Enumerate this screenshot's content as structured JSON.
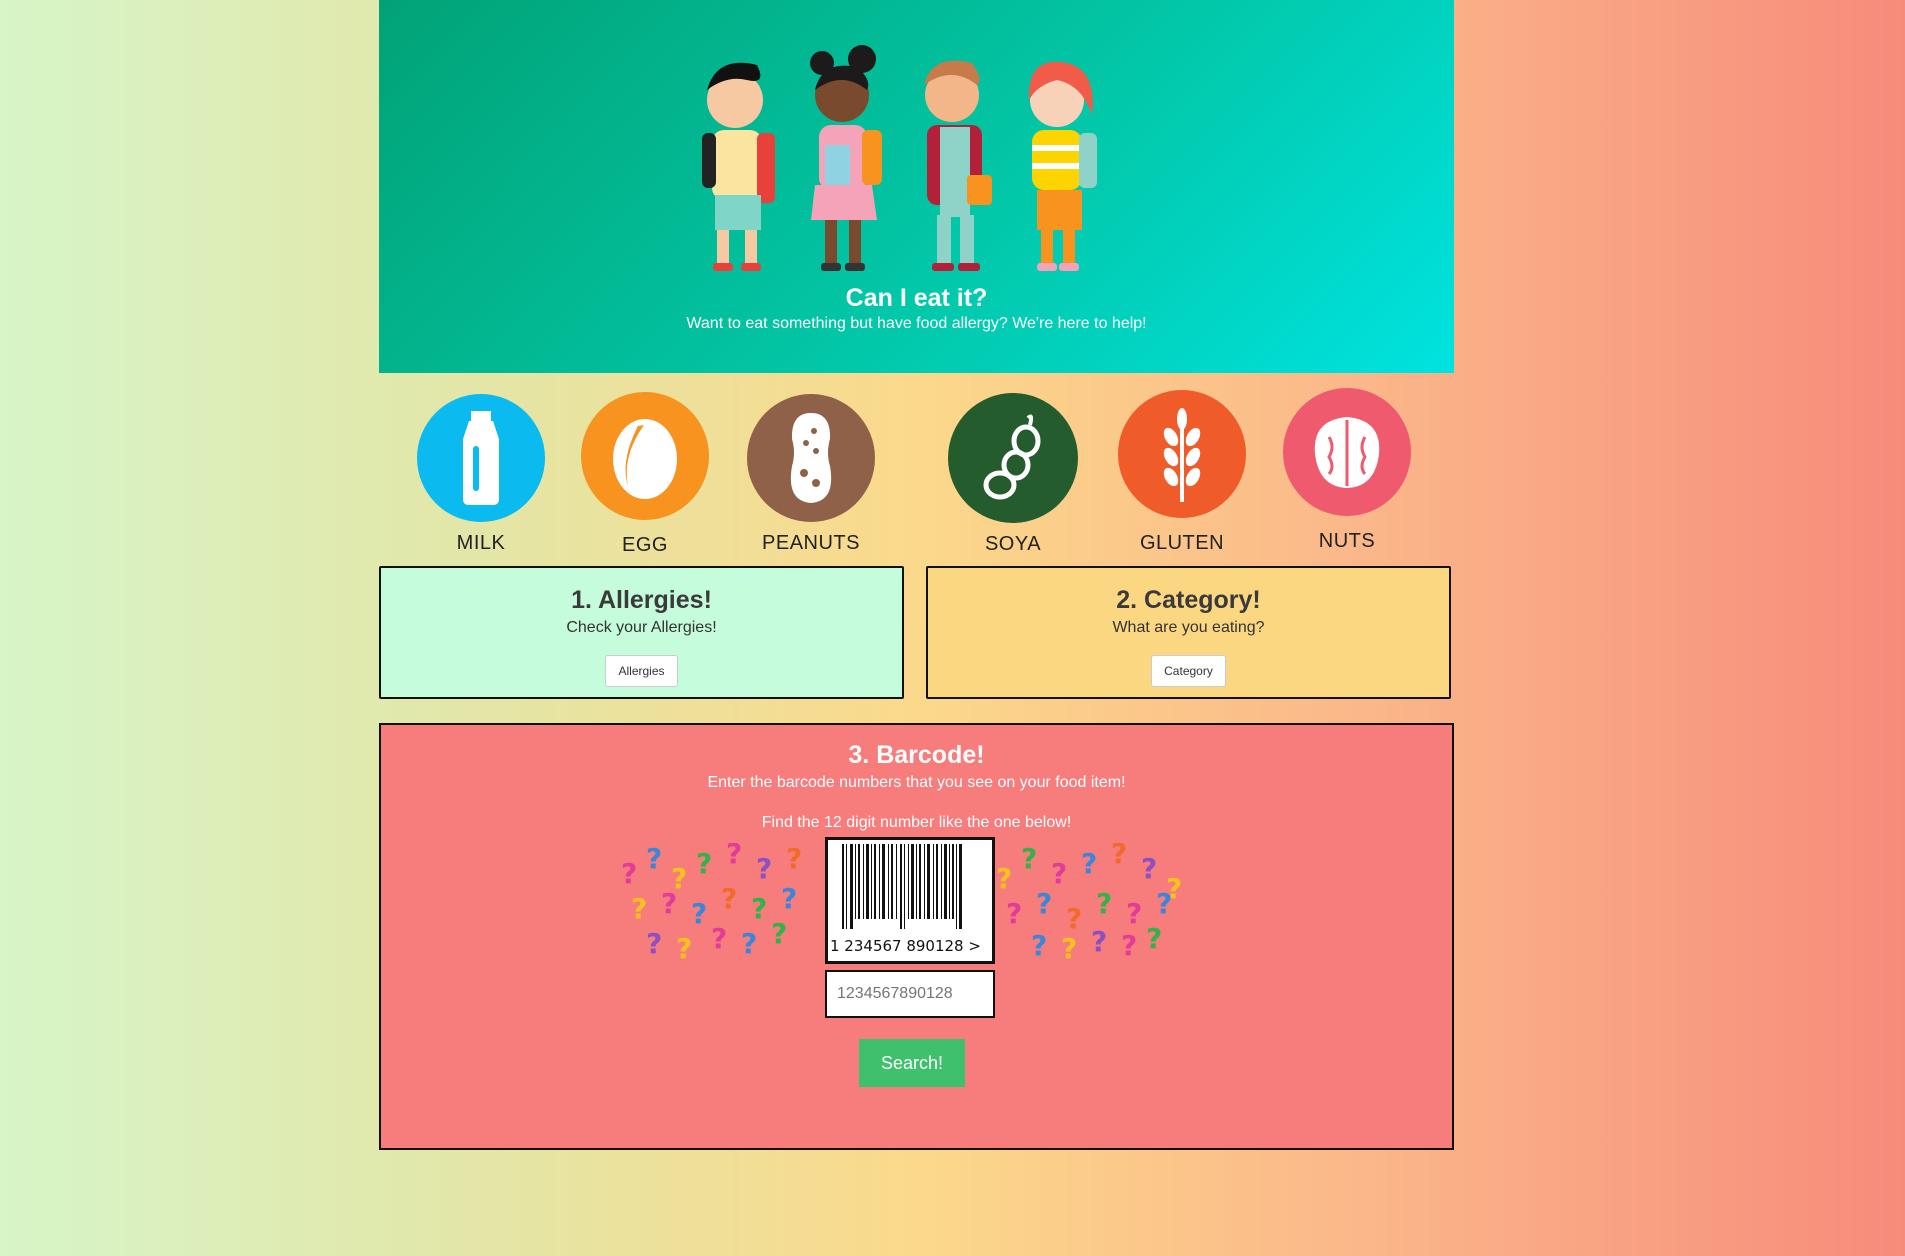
{
  "hero": {
    "title": "Can I eat it?",
    "subtitle": "Want to eat something but have food allergy? We're here to help!"
  },
  "allergens": [
    {
      "label": "MILK",
      "color": "#0bbaee",
      "icon": "milk-bottle-icon"
    },
    {
      "label": "EGG",
      "color": "#f7931e",
      "icon": "egg-icon"
    },
    {
      "label": "PEANUTS",
      "color": "#8f6149",
      "icon": "peanut-icon"
    },
    {
      "label": "SOYA",
      "color": "#255c2e",
      "icon": "soy-bean-icon"
    },
    {
      "label": "GLUTEN",
      "color": "#f05b2a",
      "icon": "wheat-icon"
    },
    {
      "label": "NUTS",
      "color": "#ef5a6e",
      "icon": "walnut-icon"
    }
  ],
  "cards": {
    "allergies": {
      "title": "1. Allergies!",
      "text": "Check your Allergies!",
      "button": "Allergies",
      "bg": "#c4fcdc"
    },
    "category": {
      "title": "2. Category!",
      "text": "What are you eating?",
      "button": "Category",
      "bg": "#fcd782"
    }
  },
  "barcode": {
    "title": "3. Barcode!",
    "text": "Enter the barcode numbers that you see on your food item!",
    "find": "Find the 12 digit number like the one below!",
    "digits": "1 234567 890128 >",
    "placeholder": "1234567890128",
    "search_label": "Search!",
    "bg": "#f77c7c",
    "button_color": "#3fc06c"
  }
}
